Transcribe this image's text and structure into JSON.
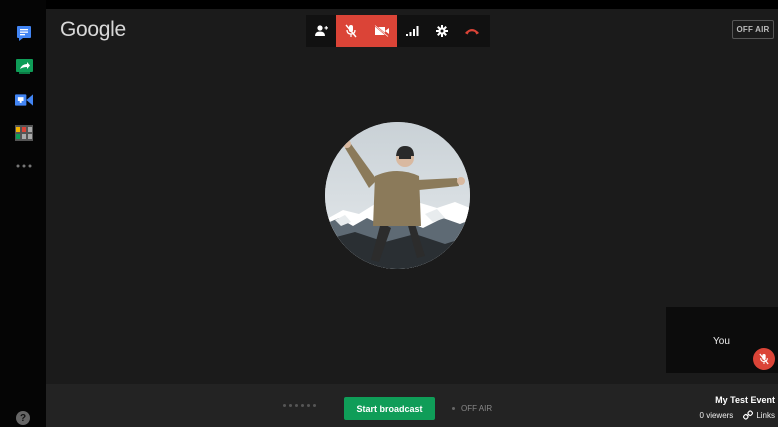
{
  "app": {
    "logo": "Google"
  },
  "rail": {
    "items": [
      {
        "name": "chat",
        "icon": "chat-icon",
        "color": "#4285f4"
      },
      {
        "name": "screenshare",
        "icon": "screenshare-icon",
        "color": "#0f9d58"
      },
      {
        "name": "remote-desktop",
        "icon": "remote-desktop-icon",
        "color": "#4285f4"
      },
      {
        "name": "control-room",
        "icon": "control-room-icon",
        "color": "#f4b400"
      },
      {
        "name": "more",
        "icon": "more-icon",
        "color": "#777777"
      }
    ],
    "help_label": "?"
  },
  "toolbar": {
    "buttons": [
      {
        "name": "invite",
        "icon": "add-person-icon",
        "active_red": false
      },
      {
        "name": "mic",
        "icon": "mic-off-icon",
        "active_red": true
      },
      {
        "name": "camera",
        "icon": "camera-off-icon",
        "active_red": true
      },
      {
        "name": "bandwidth",
        "icon": "signal-bars-icon",
        "active_red": false
      },
      {
        "name": "settings",
        "icon": "gear-icon",
        "active_red": false
      },
      {
        "name": "hangup",
        "icon": "hangup-icon",
        "active_red": false
      }
    ]
  },
  "status": {
    "top_badge": "OFF AIR",
    "bottom_status": "OFF AIR"
  },
  "self_view": {
    "label": "You"
  },
  "broadcast": {
    "start_label": "Start broadcast"
  },
  "event": {
    "title": "My Test Event",
    "viewers": "0 viewers",
    "links_label": "Links"
  },
  "colors": {
    "accent_red": "#db4437",
    "accent_green": "#0f9d58",
    "stage_bg": "#1b1b1b",
    "bar_bg": "#232323"
  }
}
